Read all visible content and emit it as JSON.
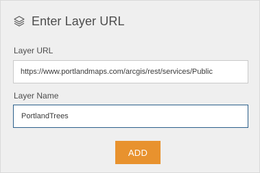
{
  "header": {
    "title": "Enter Layer URL",
    "icon": "layers-icon"
  },
  "form": {
    "url_label": "Layer URL",
    "url_value": "https://www.portlandmaps.com/arcgis/rest/services/Public",
    "name_label": "Layer Name",
    "name_value": "PortlandTrees",
    "add_label": "ADD"
  },
  "colors": {
    "panel_background": "#efefef",
    "accent_button": "#e8922e",
    "focused_border": "#2b5f8a",
    "text": "#4c4c4c"
  }
}
